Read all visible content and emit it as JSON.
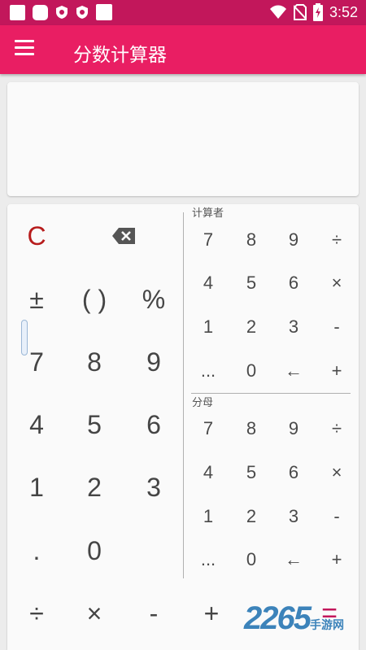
{
  "status_bar": {
    "time": "3:52",
    "icons": [
      "square-icon",
      "square-icon",
      "shield-icon",
      "shield-icon",
      "square-icon",
      "wifi-icon",
      "no-sim-icon",
      "battery-icon"
    ]
  },
  "app_bar": {
    "title": "分数计算器",
    "menu_icon": "menu-icon"
  },
  "display": {
    "value": ""
  },
  "main_keypad": {
    "clear_label": "C",
    "backspace_icon": "backspace-icon",
    "rows": [
      [
        "±",
        "( )",
        "%"
      ],
      [
        "7",
        "8",
        "9"
      ],
      [
        "4",
        "5",
        "6"
      ],
      [
        "1",
        "2",
        "3"
      ],
      [
        ".",
        "0"
      ]
    ],
    "bottom_ops": [
      "÷",
      "×",
      "-",
      "+",
      "="
    ]
  },
  "numerator_pad": {
    "label": "计算者",
    "rows": [
      [
        "7",
        "8",
        "9",
        "÷"
      ],
      [
        "4",
        "5",
        "6",
        "×"
      ],
      [
        "1",
        "2",
        "3",
        "-"
      ],
      [
        "...",
        "0",
        "←",
        "+"
      ]
    ]
  },
  "denominator_pad": {
    "label": "分母",
    "rows": [
      [
        "7",
        "8",
        "9",
        "÷"
      ],
      [
        "4",
        "5",
        "6",
        "×"
      ],
      [
        "1",
        "2",
        "3",
        "-"
      ],
      [
        "...",
        "0",
        "←",
        "+"
      ]
    ]
  },
  "watermark": {
    "text": "2265",
    "sub": "手游网"
  },
  "colors": {
    "status_bar": "#c2175b",
    "app_bar": "#e91e63",
    "clear": "#b71c1c",
    "equals": "#c2175b"
  }
}
